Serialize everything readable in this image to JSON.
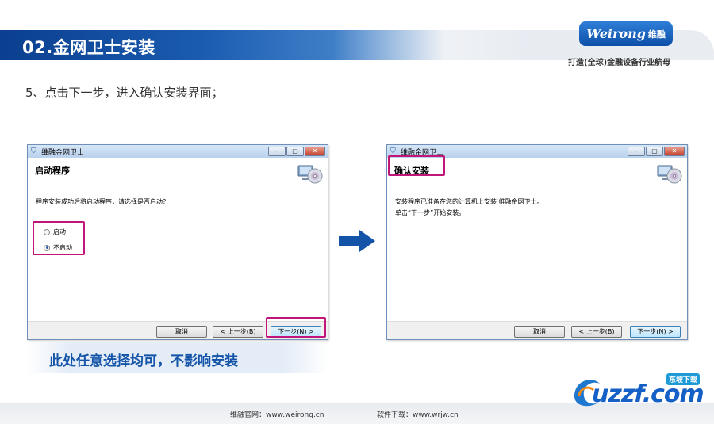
{
  "header": {
    "title": "02.金网卫士安装"
  },
  "logo": {
    "text": "Weirong",
    "cn": "维融"
  },
  "tagline": "打造(全球)金融设备行业航母",
  "instruction": "5、点击下一步，进入确认安装界面；",
  "window_left": {
    "title": "维融金网卫士",
    "heading": "启动程序",
    "message": "程序安装成功后将启动程序，请选择是否启动？",
    "options": [
      {
        "label": "启动",
        "selected": false
      },
      {
        "label": "不启动",
        "selected": true
      }
    ],
    "cancel": "取消",
    "back": "< 上一步(B)",
    "next": "下一步(N) >"
  },
  "window_right": {
    "title": "维融金网卫士",
    "heading": "确认安装",
    "line1": "安装程序已准备在您的计算机上安装 维融金网卫士。",
    "line2": "单击“下一步”开始安装。",
    "cancel": "取消",
    "back": "< 上一步(B)",
    "next": "下一步(N) >"
  },
  "callout": "此处任意选择均可，不影响安装",
  "footer": {
    "site_left": "维融官网：www.weirong.cn",
    "site_right": "软件下载：www.wrjw.cn"
  },
  "watermark": {
    "text": "uzzf.com",
    "badge": "东坡下载"
  },
  "colors": {
    "accent": "#1454a8",
    "highlight": "#c2157a",
    "arrow": "#1454a8"
  }
}
